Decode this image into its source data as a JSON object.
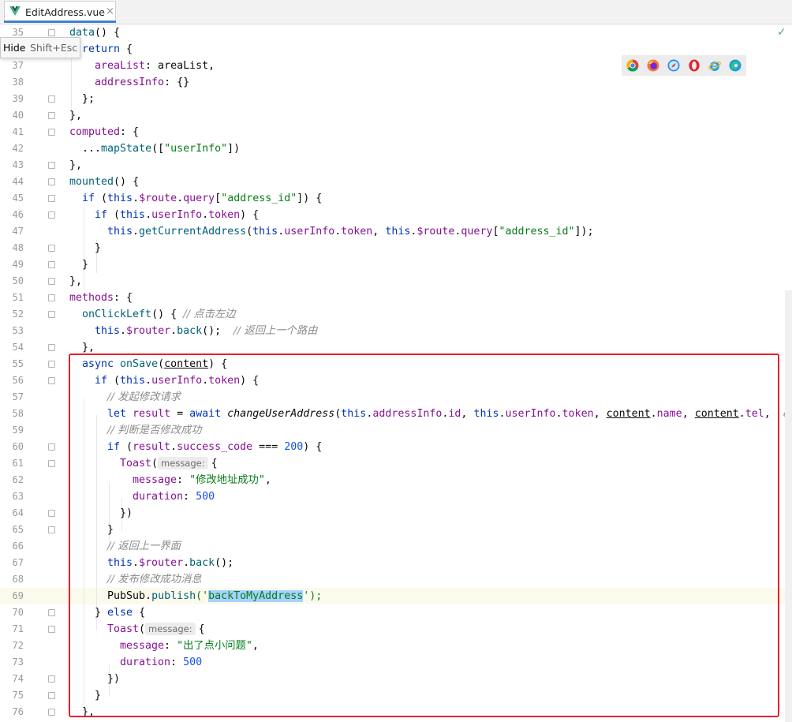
{
  "tab": {
    "file_name": "EditAddress.vue",
    "close": "×"
  },
  "tooltip": {
    "action": "Hide",
    "shortcut": "Shift+Esc"
  },
  "inspection_status": "✓",
  "browsers": [
    "chrome-icon",
    "firefox-icon",
    "safari-icon",
    "opera-icon",
    "ie-icon",
    "edge-icon"
  ],
  "lines": [
    {
      "n": "35",
      "fold": true
    },
    {
      "n": "36",
      "fold": true
    },
    {
      "n": "37",
      "fold": false
    },
    {
      "n": "38",
      "fold": false
    },
    {
      "n": "39",
      "fold": true
    },
    {
      "n": "40",
      "fold": true
    },
    {
      "n": "41",
      "fold": true
    },
    {
      "n": "42",
      "fold": false
    },
    {
      "n": "43",
      "fold": true
    },
    {
      "n": "44",
      "fold": true
    },
    {
      "n": "45",
      "fold": true
    },
    {
      "n": "46",
      "fold": true
    },
    {
      "n": "47",
      "fold": false
    },
    {
      "n": "48",
      "fold": true
    },
    {
      "n": "49",
      "fold": true
    },
    {
      "n": "50",
      "fold": true
    },
    {
      "n": "51",
      "fold": true
    },
    {
      "n": "52",
      "fold": true
    },
    {
      "n": "53",
      "fold": false
    },
    {
      "n": "54",
      "fold": true
    },
    {
      "n": "55",
      "fold": true
    },
    {
      "n": "56",
      "fold": true
    },
    {
      "n": "57",
      "fold": false
    },
    {
      "n": "58",
      "fold": false
    },
    {
      "n": "59",
      "fold": false
    },
    {
      "n": "60",
      "fold": true
    },
    {
      "n": "61",
      "fold": true
    },
    {
      "n": "62",
      "fold": false
    },
    {
      "n": "63",
      "fold": false
    },
    {
      "n": "64",
      "fold": true
    },
    {
      "n": "65",
      "fold": true
    },
    {
      "n": "66",
      "fold": false
    },
    {
      "n": "67",
      "fold": false
    },
    {
      "n": "68",
      "fold": false
    },
    {
      "n": "69",
      "fold": false
    },
    {
      "n": "70",
      "fold": true
    },
    {
      "n": "71",
      "fold": true
    },
    {
      "n": "72",
      "fold": false
    },
    {
      "n": "73",
      "fold": false
    },
    {
      "n": "74",
      "fold": true
    },
    {
      "n": "75",
      "fold": true
    },
    {
      "n": "76",
      "fold": true
    }
  ],
  "code": {
    "l35": [
      "data",
      "() {"
    ],
    "l36": [
      "return",
      " {"
    ],
    "l37": [
      "areaList",
      ": areaList,"
    ],
    "l38": [
      "addressInfo",
      ": {}"
    ],
    "l39": [
      "};"
    ],
    "l40": [
      "},"
    ],
    "l41": [
      "computed",
      ": {"
    ],
    "l42": [
      "...",
      "mapState",
      "([",
      "\"userInfo\"",
      "])"
    ],
    "l43": [
      "},"
    ],
    "l44": [
      "mounted",
      "() {"
    ],
    "l45": [
      "if",
      " (",
      "this",
      ".",
      "$route",
      ".",
      "query",
      "[",
      "\"address_id\"",
      "]) {"
    ],
    "l46": [
      "if",
      " (",
      "this",
      ".",
      "userInfo",
      ".",
      "token",
      ") {"
    ],
    "l47": [
      "this",
      ".",
      "getCurrentAddress",
      "(",
      "this",
      ".",
      "userInfo",
      ".",
      "token",
      ", ",
      "this",
      ".",
      "$route",
      ".",
      "query",
      "[",
      "\"address_id\"",
      "]);"
    ],
    "l48": [
      "}"
    ],
    "l49": [
      "}"
    ],
    "l50": [
      "},"
    ],
    "l51": [
      "methods",
      ": {"
    ],
    "l52": [
      "onClickLeft",
      "() { ",
      "// 点击左边"
    ],
    "l53": [
      "this",
      ".",
      "$router",
      ".",
      "back",
      "();  ",
      "// 返回上一个路由"
    ],
    "l54": [
      "},"
    ],
    "l55": [
      "async",
      " ",
      "onSave",
      "(",
      "content",
      ") {"
    ],
    "l56": [
      "if",
      " (",
      "this",
      ".",
      "userInfo",
      ".",
      "token",
      ") {"
    ],
    "l57": [
      "// 发起修改请求"
    ],
    "l58": [
      "let",
      " ",
      "result",
      " = ",
      "await",
      " ",
      "changeUserAddress",
      "(",
      "this",
      ".",
      "addressInfo",
      ".",
      "id",
      ", ",
      "this",
      ".",
      "userInfo",
      ".",
      "token",
      ", ",
      "content",
      ".",
      "name",
      ", ",
      "content",
      ".",
      "tel",
      ",  ",
      "ad"
    ],
    "l59": [
      "// 判断是否修改成功"
    ],
    "l60": [
      "if",
      " (",
      "result",
      ".",
      "success_code",
      " === ",
      "200",
      ") {"
    ],
    "l61": [
      "Toast",
      "(",
      "message:",
      "{"
    ],
    "l62": [
      "message",
      ": ",
      "\"修改地址成功\"",
      ","
    ],
    "l63": [
      "duration",
      ": ",
      "500"
    ],
    "l64": [
      "})"
    ],
    "l65": [
      "}"
    ],
    "l66": [
      "// 返回上一界面"
    ],
    "l67": [
      "this",
      ".",
      "$router",
      ".",
      "back",
      "();"
    ],
    "l68": [
      "// 发布修改成功消息"
    ],
    "l69": [
      "PubSub",
      ".",
      "publish",
      "('",
      "backToMyAddress",
      "');"
    ],
    "l70": [
      "}",
      " else ",
      "{"
    ],
    "l71": [
      "Toast",
      "(",
      "message:",
      "{"
    ],
    "l72": [
      "message",
      ": ",
      "\"出了点小问题\"",
      ","
    ],
    "l73": [
      "duration",
      ": ",
      "500"
    ],
    "l74": [
      "})"
    ],
    "l75": [
      "}"
    ],
    "l76": [
      "},"
    ]
  },
  "colors": {
    "highlight_box": "#e8202a",
    "keyword": "#0033b3",
    "property": "#871094",
    "string": "#067d17",
    "number": "#1750eb"
  }
}
